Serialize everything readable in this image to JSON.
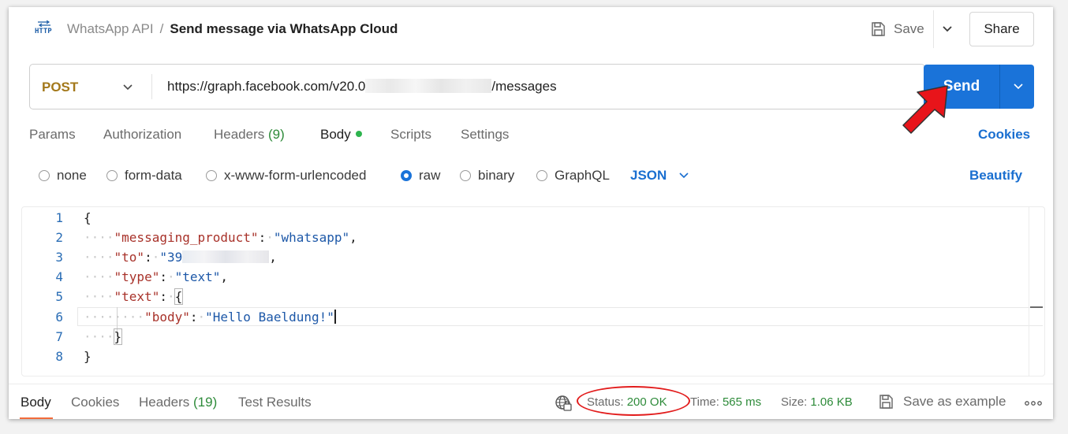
{
  "header": {
    "icon_text": "HTTP",
    "collection": "WhatsApp API",
    "separator": "/",
    "request_name": "Send message via WhatsApp Cloud",
    "save_label": "Save",
    "share_label": "Share"
  },
  "request": {
    "method": "POST",
    "url_prefix": "https://graph.facebook.com/v20.0",
    "url_suffix": "/messages",
    "send_label": "Send"
  },
  "tabs": {
    "params": "Params",
    "authorization": "Authorization",
    "headers_label": "Headers",
    "headers_count": "(9)",
    "body": "Body",
    "scripts": "Scripts",
    "settings": "Settings",
    "cookies": "Cookies"
  },
  "body_types": {
    "none": "none",
    "form_data": "form-data",
    "urlencoded": "x-www-form-urlencoded",
    "raw": "raw",
    "binary": "binary",
    "graphql": "GraphQL",
    "selected": "raw",
    "format": "JSON",
    "beautify": "Beautify"
  },
  "editor": {
    "line_numbers": [
      "1",
      "2",
      "3",
      "4",
      "5",
      "6",
      "7",
      "8"
    ],
    "open_brace": "{",
    "close_brace": "}",
    "dots2": "····",
    "dots3": "········",
    "l2_key": "\"messaging_product\"",
    "l2_val": "\"whatsapp\"",
    "l3_key": "\"to\"",
    "l3_val": "\"39",
    "l4_key": "\"type\"",
    "l4_val": "\"text\"",
    "l5_key": "\"text\"",
    "l6_key": "\"body\"",
    "l6_val": "\"Hello Baeldung!\"",
    "colon": ":",
    "comma": ","
  },
  "response_bar": {
    "body": "Body",
    "cookies": "Cookies",
    "headers_label": "Headers",
    "headers_count": "(19)",
    "test_results": "Test Results",
    "status_label": "Status:",
    "status_value": "200 OK",
    "time_label": "Time:",
    "time_value": "565 ms",
    "size_label": "Size:",
    "size_value": "1.06 KB",
    "save_example": "Save as example"
  },
  "colors": {
    "accent": "#1a73d9",
    "method": "#a3781a",
    "success": "#2e8b3a",
    "annotation": "#e21c1c",
    "active_tab_underline": "#f26b3a"
  },
  "icons": [
    "http-icon",
    "save-icon",
    "chevron-down-icon",
    "globe-icon",
    "more-icon",
    "red-arrow-annotation"
  ]
}
